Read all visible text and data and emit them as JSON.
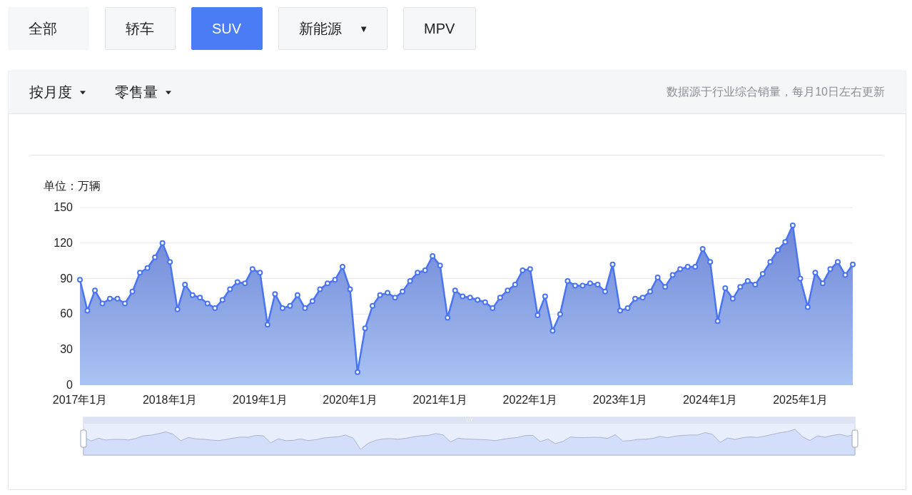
{
  "filters": [
    {
      "label": "全部",
      "kind": "plain",
      "selected": false,
      "dropdown": false
    },
    {
      "label": "轿车",
      "kind": "outlined",
      "selected": false,
      "dropdown": false
    },
    {
      "label": "SUV",
      "kind": "outlined",
      "selected": true,
      "dropdown": false
    },
    {
      "label": "新能源",
      "kind": "outlined",
      "selected": false,
      "dropdown": true,
      "caret": "▼"
    },
    {
      "label": "MPV",
      "kind": "outlined",
      "selected": false,
      "dropdown": false
    }
  ],
  "toolbar": {
    "selectors": [
      {
        "label": "按月度"
      },
      {
        "label": "零售量"
      }
    ],
    "note": "数据源于行业综合销量，每月10日左右更新"
  },
  "chart": {
    "chart_data": {
      "type": "area",
      "ylabel": "单位：万辆",
      "ylim": [
        0,
        150
      ],
      "yticks": [
        0,
        30,
        60,
        90,
        120,
        150
      ],
      "grid": true,
      "categories": [
        "2017年1月",
        null,
        null,
        null,
        null,
        null,
        null,
        null,
        null,
        null,
        null,
        null,
        "2018年1月",
        null,
        null,
        null,
        null,
        null,
        null,
        null,
        null,
        null,
        null,
        null,
        "2019年1月",
        null,
        null,
        null,
        null,
        null,
        null,
        null,
        null,
        null,
        null,
        null,
        "2020年1月",
        null,
        null,
        null,
        null,
        null,
        null,
        null,
        null,
        null,
        null,
        null,
        "2021年1月",
        null,
        null,
        null,
        null,
        null,
        null,
        null,
        null,
        null,
        null,
        null,
        "2022年1月",
        null,
        null,
        null,
        null,
        null,
        null,
        null,
        null,
        null,
        null,
        null,
        "2023年1月",
        null,
        null,
        null,
        null,
        null,
        null,
        null,
        null,
        null,
        null,
        null,
        "2024年1月",
        null,
        null,
        null,
        null,
        null,
        null,
        null,
        null,
        null,
        null,
        null,
        "2025年1月",
        null,
        null,
        null,
        null,
        null,
        null,
        null
      ],
      "series": [
        {
          "color": "#4a74f0",
          "values": [
            89,
            63,
            80,
            69,
            73,
            73,
            69,
            79,
            95,
            99,
            108,
            120,
            104,
            64,
            85,
            76,
            74,
            69,
            65,
            72,
            81,
            87,
            86,
            98,
            95,
            51,
            77,
            65,
            67,
            76,
            65,
            71,
            81,
            86,
            89,
            100,
            81,
            11,
            48,
            67,
            76,
            78,
            74,
            79,
            88,
            95,
            97,
            109,
            101,
            57,
            80,
            75,
            74,
            72,
            70,
            65,
            74,
            80,
            85,
            97,
            98,
            59,
            75,
            46,
            60,
            88,
            84,
            84,
            86,
            85,
            79,
            102,
            63,
            65,
            73,
            74,
            79,
            91,
            83,
            93,
            98,
            100,
            100,
            115,
            104,
            54,
            82,
            73,
            83,
            88,
            85,
            94,
            104,
            114,
            121,
            135,
            90,
            66,
            95,
            86,
            98,
            104,
            93,
            102
          ]
        }
      ]
    },
    "range": {
      "level": 1
    }
  }
}
